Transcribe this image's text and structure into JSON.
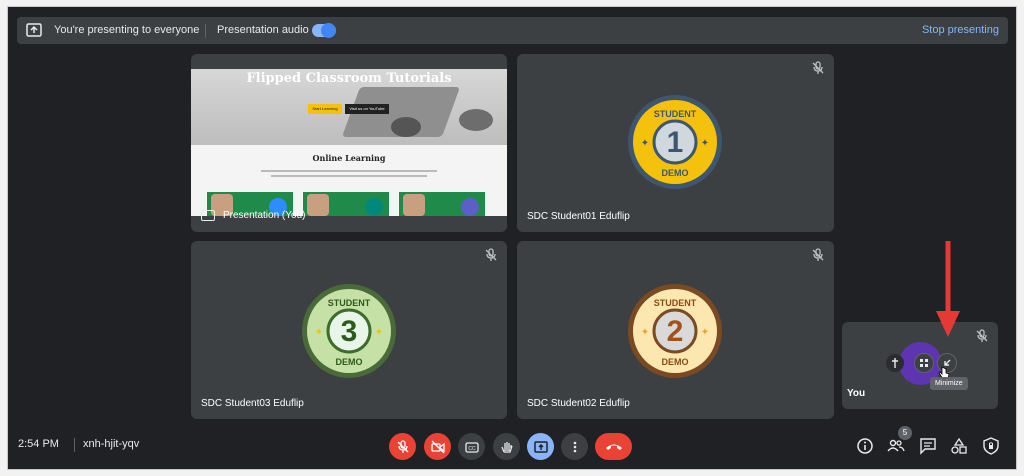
{
  "banner": {
    "presenting_text": "You're presenting to everyone",
    "audio_label": "Presentation audio",
    "stop_label": "Stop presenting"
  },
  "presentation": {
    "slide_title": "Flipped Classroom Tutorials",
    "slide_btn_start": "Start Learning",
    "slide_btn_youtube": "Visit us on YouTube",
    "slide_subtitle": "Online Learning",
    "tile_label": "Presentation (You)"
  },
  "tiles": {
    "student01": {
      "name": "SDC Student01 Eduflip",
      "badge_top": "STUDENT",
      "badge_number": "1",
      "badge_bottom": "DEMO"
    },
    "student03": {
      "name": "SDC Student03 Eduflip",
      "badge_top": "STUDENT",
      "badge_number": "3",
      "badge_bottom": "DEMO"
    },
    "student02": {
      "name": "SDC Student02 Eduflip",
      "badge_top": "STUDENT",
      "badge_number": "2",
      "badge_bottom": "DEMO"
    }
  },
  "self_tile": {
    "name": "You",
    "tooltip": "Minimize"
  },
  "footer": {
    "time": "2:54 PM",
    "meeting_code": "xnh-hjit-yqv",
    "participant_count": "5"
  },
  "colors": {
    "background": "#202124",
    "tile": "#3c4043",
    "accent_blue": "#8ab4f8",
    "end_red": "#ea4335",
    "badge1": "#f4c20d",
    "badge3": "#7cb342",
    "badge2": "#e9a33a",
    "avatar": "#5e35b1",
    "arrow": "#e53935"
  }
}
